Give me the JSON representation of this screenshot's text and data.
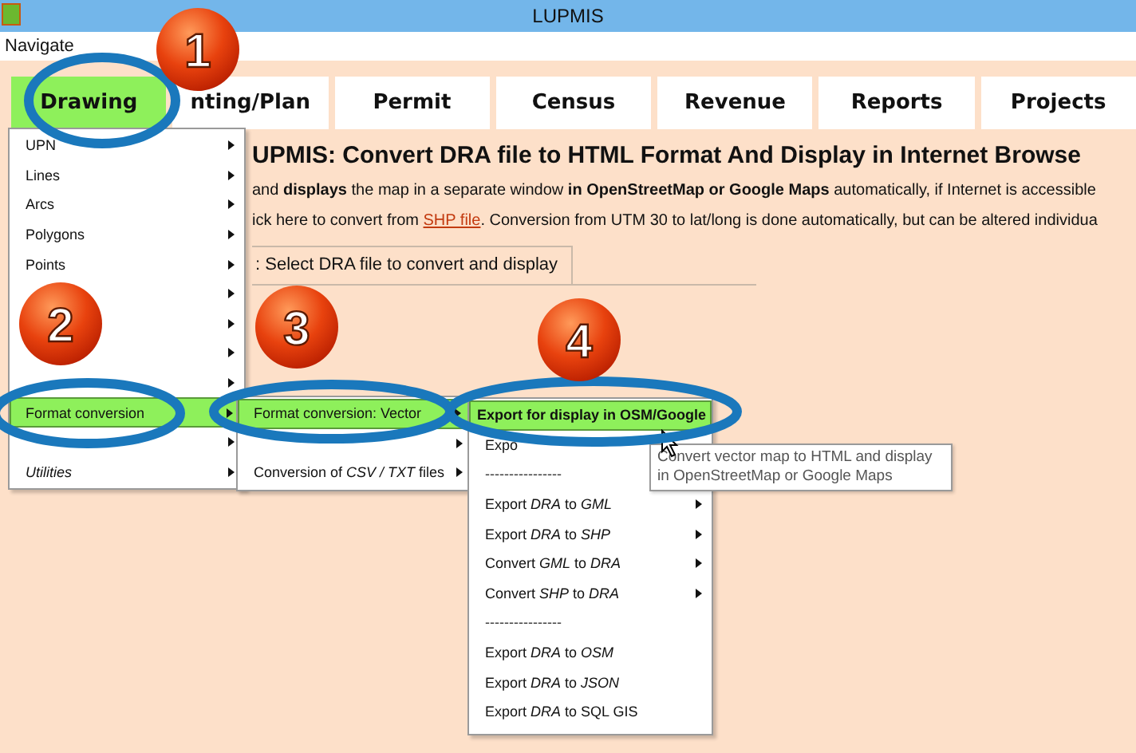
{
  "window": {
    "title": "LUPMIS"
  },
  "menu_bar": [
    "Navigate"
  ],
  "tabs": [
    {
      "label": "Drawing",
      "selected": true
    },
    {
      "label": "nting/Plan",
      "selected": false
    },
    {
      "label": "Permit",
      "selected": false
    },
    {
      "label": "Census",
      "selected": false
    },
    {
      "label": "Revenue",
      "selected": false
    },
    {
      "label": "Reports",
      "selected": false
    },
    {
      "label": "Projects",
      "selected": false
    }
  ],
  "content": {
    "title": "UPMIS: Convert DRA file to HTML Format And Display in Internet Browse",
    "line_1": "and **displays** the map in a separate window **in OpenStreetMap or Google Maps** automatically, if Internet is accessible",
    "line_2_before": "ick here to convert from",
    "line_2_link": "SHP file",
    "line_2_after": ". Conversion from UTM 30 to lat/long is done automatically, but can be altered individua",
    "panel_tab": ": Select DRA file to convert and display"
  },
  "drawing_menu": [
    {
      "label": "UPN",
      "selected": false,
      "italic": false
    },
    {
      "label": "Lines",
      "selected": false,
      "italic": false
    },
    {
      "label": "Arcs",
      "selected": false,
      "italic": false
    },
    {
      "label": "Polygons",
      "selected": false,
      "italic": false
    },
    {
      "label": "Points",
      "selected": false,
      "italic": false
    },
    {
      "selected": false,
      "italic": false
    },
    {
      "selected": false,
      "italic": false
    },
    {
      "selected": false,
      "italic": false
    },
    {
      "selected": false,
      "italic": false
    },
    {
      "label": "Format conversion",
      "selected": true,
      "italic": false
    },
    {
      "selected": false,
      "italic": false
    },
    {
      "label": "Utilities",
      "selected": false,
      "italic": true
    }
  ],
  "format_menu": [
    {
      "label": "Format conversion: Vector",
      "selected": true
    },
    {
      "selected": false
    },
    {
      "label": "Conversion of *CSV / TXT* files",
      "selected": false
    }
  ],
  "vector_menu": [
    {
      "kind": "item",
      "label": "Export for display in OSM/Google",
      "selected": true,
      "submenu": false
    },
    {
      "kind": "item",
      "label": "Expo",
      "selected": false,
      "submenu": false
    },
    {
      "kind": "separator",
      "label": "----------------"
    },
    {
      "kind": "item",
      "label": "Export *DRA* to *GML*",
      "selected": false,
      "submenu": true
    },
    {
      "kind": "item",
      "label": "Export *DRA* to *SHP*",
      "selected": false,
      "submenu": true
    },
    {
      "kind": "item",
      "label": "Convert *GML* to *DRA*",
      "selected": false,
      "submenu": true
    },
    {
      "kind": "item",
      "label": "Convert *SHP* to *DRA*",
      "selected": false,
      "submenu": true
    },
    {
      "kind": "separator",
      "label": "----------------"
    },
    {
      "kind": "item",
      "label": "Export *DRA* to *OSM*",
      "selected": false,
      "submenu": false
    },
    {
      "kind": "item",
      "label": "Export *DRA* to *JSON*",
      "selected": false,
      "submenu": false
    },
    {
      "kind": "item",
      "label": "Export *DRA* to SQL GIS",
      "selected": false,
      "submenu": false
    }
  ],
  "tooltip": "Convert vector map to HTML and display in OpenStreetMap or Google Maps",
  "annotations": [
    "1",
    "2",
    "3",
    "4"
  ]
}
